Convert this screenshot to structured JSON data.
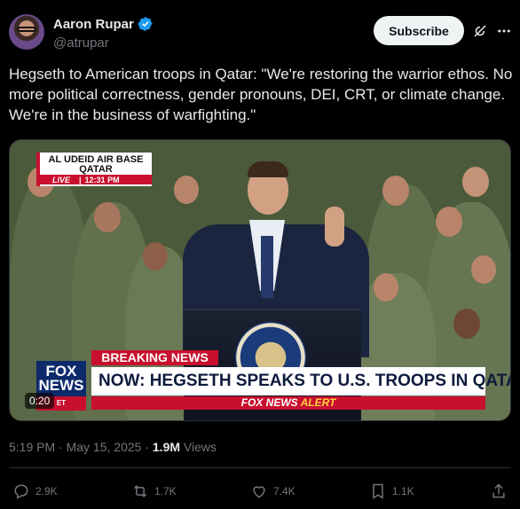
{
  "author": {
    "name": "Aaron Rupar",
    "handle": "@atrupar"
  },
  "header": {
    "subscribe_label": "Subscribe"
  },
  "tweet": {
    "text": "Hegseth to American troops in Qatar: \"We're restoring the warrior ethos. No more political correctness, gender pronouns, DEI, CRT, or climate change. We're in the business of warfighting.\""
  },
  "video": {
    "location_line1": "AL UDEID AIR BASE",
    "location_line2": "QATAR",
    "live_label": "LIVE",
    "live_time": "12:31 PM",
    "breaking_label": "BREAKING NEWS",
    "headline": "NOW: HEGSETH SPEAKS TO U.S. TROOPS IN QATAR",
    "alert_brand": "FOX NEWS",
    "alert_word": "ALERT",
    "logo_text_top": "FOX",
    "logo_text_bottom": "NEWS",
    "logo_et": "ET",
    "elapsed": "0:20"
  },
  "meta": {
    "time": "5:19 PM",
    "separator": " · ",
    "date": "May 15, 2025",
    "views_count": "1.9M",
    "views_label": "Views"
  },
  "actions": {
    "replies": "2.9K",
    "reposts": "1.7K",
    "likes": "7.4K",
    "bookmarks": "1.1K"
  },
  "colors": {
    "accent": "#1d9bf0",
    "fox_red": "#c8102e",
    "fox_blue": "#0d2a6b"
  },
  "icons": [
    "verified-badge-icon",
    "grok-icon",
    "more-icon",
    "reply-icon",
    "repost-icon",
    "like-icon",
    "bookmark-icon",
    "share-icon"
  ]
}
